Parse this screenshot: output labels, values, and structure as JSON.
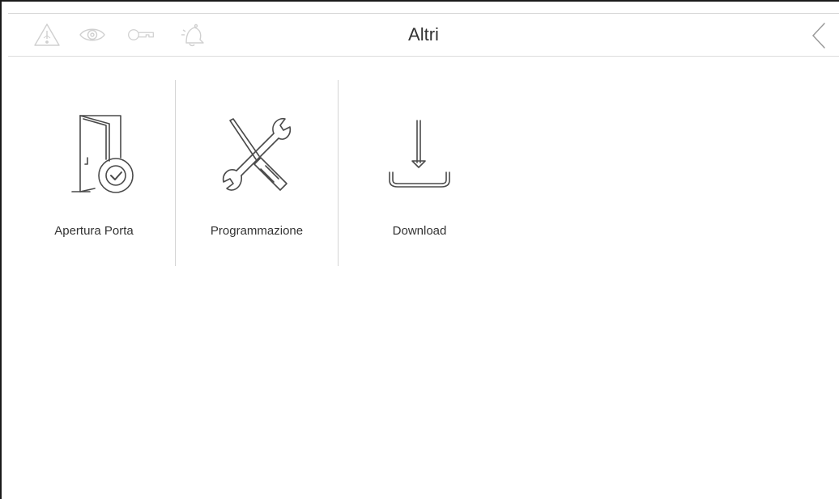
{
  "header": {
    "title": "Altri",
    "status_icons": [
      "warning-icon",
      "eye-icon",
      "key-icon",
      "bell-icon"
    ],
    "back_icon": "chevron-left-icon"
  },
  "menu": {
    "items": [
      {
        "label": "Apertura Porta",
        "icon": "door-open-icon"
      },
      {
        "label": "Programmazione",
        "icon": "tools-icon"
      },
      {
        "label": "Download",
        "icon": "download-icon"
      }
    ]
  },
  "colors": {
    "icon_inactive": "#d0d0d0",
    "icon_stroke": "#4a4a4a",
    "text": "#333333",
    "divider": "#d4d4d4"
  }
}
